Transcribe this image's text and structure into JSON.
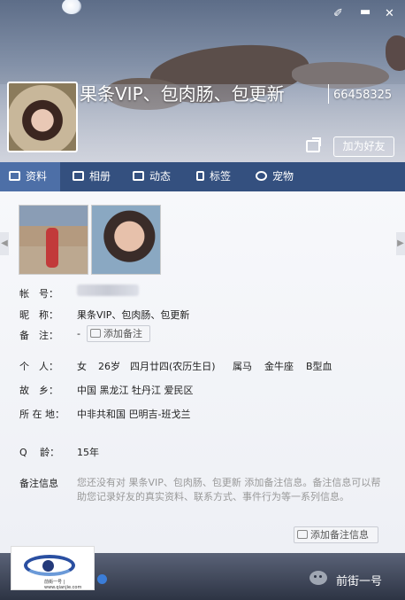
{
  "header": {
    "nickname": "果条VIP、包肉肠、包更新",
    "qq_number": "66458325",
    "add_friend_label": "加为好友"
  },
  "controls": {
    "skin_icon": "brush-icon",
    "minimize_icon": "minimize-icon",
    "close_icon": "close-icon"
  },
  "tabs": [
    {
      "label": "资料",
      "icon": "profile-card-icon",
      "active": true
    },
    {
      "label": "相册",
      "icon": "photo-album-icon",
      "active": false
    },
    {
      "label": "动态",
      "icon": "feed-list-icon",
      "active": false
    },
    {
      "label": "标签",
      "icon": "bookmark-icon",
      "active": false
    },
    {
      "label": "宠物",
      "icon": "pet-paw-icon",
      "active": false
    }
  ],
  "profile": {
    "account": {
      "label": "帐　号：",
      "value_hidden": true
    },
    "nickname": {
      "label": "昵　称：",
      "value": "果条VIP、包肉肠、包更新"
    },
    "remark": {
      "label": "备　注：",
      "value": "-",
      "button": "添加备注"
    },
    "personal": {
      "label": "个　人：",
      "values": [
        "女",
        "26岁",
        "四月廿四(农历生日)",
        "属马",
        "金牛座",
        "B型血"
      ]
    },
    "hometown": {
      "label": "故　乡：",
      "value": "中国 黑龙江 牡丹江 爱民区"
    },
    "location": {
      "label": "所 在 地：",
      "value": "中非共和国 巴明吉-班戈兰"
    },
    "q_age": {
      "label": "Q　 龄：",
      "value": "15年"
    },
    "remark_info": {
      "label": "备注信息",
      "text": "您还没有对 果条VIP、包肉肠、包更新 添加备注信息。备注信息可以帮助您记录好友的真实资料、联系方式、事件行为等一系列信息。",
      "button": "添加备注信息"
    }
  },
  "footer": {
    "watermark_text": "前街一号",
    "logo_caption": "前街一号 | www.qianjie.com"
  },
  "colors": {
    "tab_bar": "#34507f",
    "tab_active": "#4d6fa7",
    "footer": "#2d3444"
  }
}
